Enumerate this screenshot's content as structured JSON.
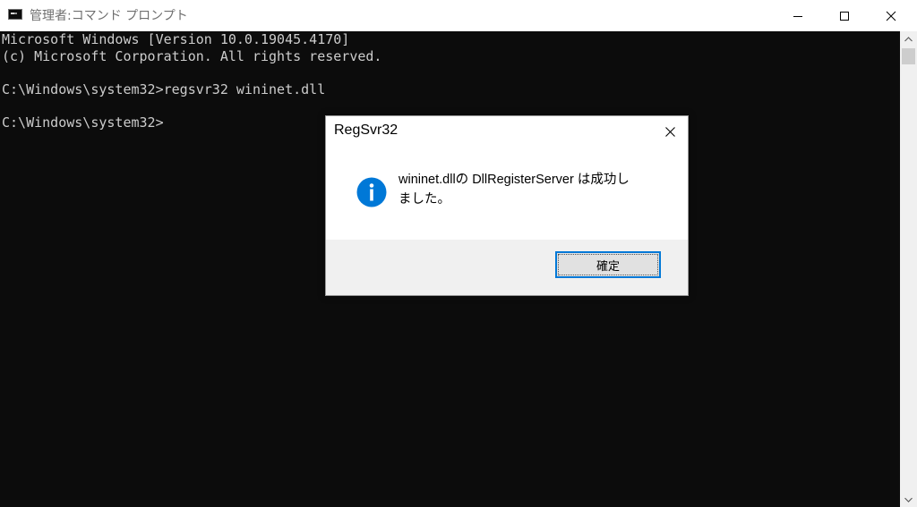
{
  "window": {
    "title": "管理者:コマンド プロンプト",
    "icon": "command-prompt-icon",
    "controls": [
      "minimize-icon",
      "maximize-icon",
      "close-icon"
    ]
  },
  "console": {
    "lines": [
      "Microsoft Windows [Version 10.0.19045.4170]",
      "(c) Microsoft Corporation. All rights reserved.",
      "",
      "C:\\Windows\\system32>regsvr32 wininet.dll",
      "",
      "C:\\Windows\\system32>"
    ]
  },
  "dialog": {
    "title": "RegSvr32",
    "icon": "information-icon",
    "message_lines": [
      "wininet.dllの DllRegisterServer は成功し",
      "ました。"
    ],
    "ok_label": "確定"
  },
  "colors": {
    "console_bg": "#0c0c0c",
    "console_text": "#cccccc",
    "info_blue": "#0078d7",
    "button_focus_border": "#0078d7",
    "dialog_footer": "#f0f0f0"
  }
}
